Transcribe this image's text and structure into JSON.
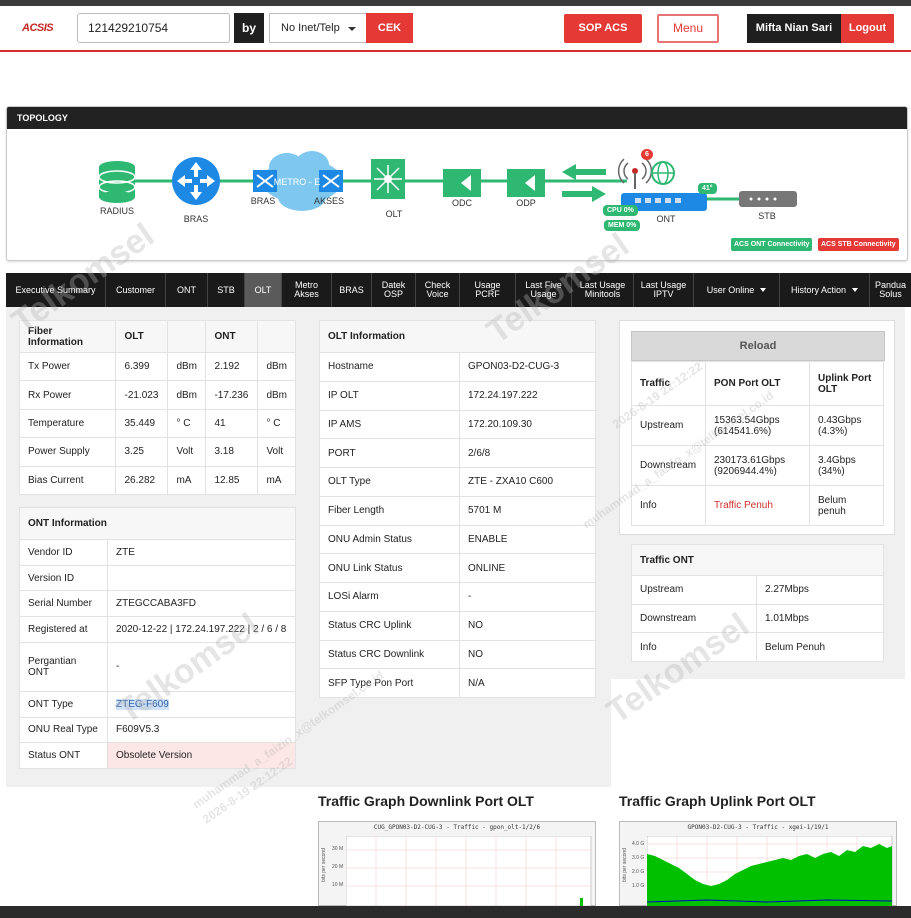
{
  "header": {
    "logo": "ACSIS",
    "search_value": "121429210754",
    "by_label": "by",
    "select_value": "No Inet/Telp",
    "cek_label": "CEK",
    "sop_label": "SOP ACS",
    "menu_label": "Menu",
    "user_name": "Mifta Nian Sari",
    "logout_label": "Logout"
  },
  "topology": {
    "title": "TOPOLOGY",
    "nodes": {
      "radius": "RADIUS",
      "bras": "BRAS",
      "metro_bras": "BRAS",
      "metro": "METRO - E",
      "akses": "AKSES",
      "olt": "OLT",
      "odc": "ODC",
      "odp": "ODP",
      "ont": "ONT",
      "stb": "STB"
    },
    "badges": {
      "notif": "6",
      "temp": "41°",
      "cpu": "CPU 0%",
      "mem": "MEM 0%"
    },
    "acs_ont": "ACS ONT Connectivity",
    "acs_stb": "ACS STB Connectivity"
  },
  "tabs": [
    {
      "l1": "Executive Summary",
      "l2": ""
    },
    {
      "l1": "Customer",
      "l2": ""
    },
    {
      "l1": "ONT",
      "l2": ""
    },
    {
      "l1": "STB",
      "l2": ""
    },
    {
      "l1": "OLT",
      "l2": ""
    },
    {
      "l1": "Metro",
      "l2": "Akses"
    },
    {
      "l1": "BRAS",
      "l2": ""
    },
    {
      "l1": "Datek",
      "l2": "OSP"
    },
    {
      "l1": "Check",
      "l2": "Voice"
    },
    {
      "l1": "Usage",
      "l2": "PCRF"
    },
    {
      "l1": "Last Five",
      "l2": "Usage"
    },
    {
      "l1": "Last Usage",
      "l2": "Minitools"
    },
    {
      "l1": "Last Usage",
      "l2": "IPTV"
    },
    {
      "l1": "User Online",
      "l2": ""
    },
    {
      "l1": "History Action",
      "l2": ""
    },
    {
      "l1": "Pandua",
      "l2": "Solus"
    }
  ],
  "fiber": {
    "headers": [
      "Fiber Information",
      "OLT",
      "",
      "ONT",
      ""
    ],
    "rows": [
      [
        "Tx Power",
        "6.399",
        "dBm",
        "2.192",
        "dBm"
      ],
      [
        "Rx Power",
        "-21.023",
        "dBm",
        "-17.236",
        "dBm"
      ],
      [
        "Temperature",
        "35.449",
        "° C",
        "41",
        "° C"
      ],
      [
        "Power Supply",
        "3.25",
        "Volt",
        "3.18",
        "Volt"
      ],
      [
        "Bias Current",
        "26.282",
        "mA",
        "12.85",
        "mA"
      ]
    ]
  },
  "ont": {
    "title": "ONT Information",
    "rows": [
      [
        "Vendor ID",
        "ZTE"
      ],
      [
        "Version ID",
        ""
      ],
      [
        "Serial Number",
        "ZTEGCCABA3FD"
      ],
      [
        "Registered at",
        "2020-12-22 | 172.24.197.222 | 2 / 6 / 8"
      ],
      [
        "Pergantian ONT",
        "-"
      ],
      [
        "ONT Type",
        "ZTEG-F609"
      ],
      [
        "ONU Real Type",
        "F609V5.3"
      ],
      [
        "Status ONT",
        "Obsolete Version"
      ]
    ]
  },
  "olt": {
    "title": "OLT Information",
    "rows": [
      [
        "Hostname",
        "GPON03-D2-CUG-3"
      ],
      [
        "IP OLT",
        "172.24.197.222"
      ],
      [
        "IP AMS",
        "172.20.109.30"
      ],
      [
        "PORT",
        "2/6/8"
      ],
      [
        "OLT Type",
        "ZTE - ZXA10 C600"
      ],
      [
        "Fiber Length",
        "5701 M"
      ],
      [
        "ONU Admin Status",
        "ENABLE"
      ],
      [
        "ONU Link Status",
        "ONLINE"
      ],
      [
        "LOSi Alarm",
        "-"
      ],
      [
        "Status CRC Uplink",
        "NO"
      ],
      [
        "Status CRC Downlink",
        "NO"
      ],
      [
        "SFP Type Pon Port",
        "N/A"
      ]
    ]
  },
  "traffic": {
    "reload": "Reload",
    "headers": [
      "Traffic",
      "PON Port OLT",
      "Uplink Port OLT"
    ],
    "rows": [
      [
        "Upstream",
        "15363.54Gbps (614541.6%)",
        "0.43Gbps (4.3%)"
      ],
      [
        "Downstream",
        "230173.61Gbps (9206944.4%)",
        "3.4Gbps (34%)"
      ],
      [
        "Info",
        "Traffic Penuh",
        "Belum penuh"
      ]
    ]
  },
  "traffic_ont": {
    "title": "Traffic ONT",
    "rows": [
      [
        "Upstream",
        "2.27Mbps"
      ],
      [
        "Downstream",
        "1.01Mbps"
      ],
      [
        "Info",
        "Belum Penuh"
      ]
    ]
  },
  "graphs": {
    "downlink_title": "Traffic Graph Downlink Port OLT",
    "uplink_title": "Traffic Graph Uplink Port OLT",
    "downlink_caption": "CUG_GPON03-D2-CUG-3 - Traffic - gpon_olt-1/2/6",
    "uplink_caption": "GPON03-D2-CUG-3 - Traffic - xgei-1/19/1",
    "y_label": "bits per second",
    "down_ticks": [
      "30 M",
      "20 M",
      "10 M",
      "0"
    ],
    "up_ticks": [
      "4.0 G",
      "3.0 G",
      "2.0 G",
      "1.0 G"
    ]
  },
  "watermarks": [
    "Telkomsel",
    "muhammad_a_faizin_x@telkomsel.co.id",
    "2026-8-19 22:12:22"
  ],
  "colors": {
    "accent": "#e53935",
    "dark": "#1f1f1f",
    "node": "#2eb872",
    "bras": "#1e88e5",
    "cloud": "#7ec8f0"
  }
}
